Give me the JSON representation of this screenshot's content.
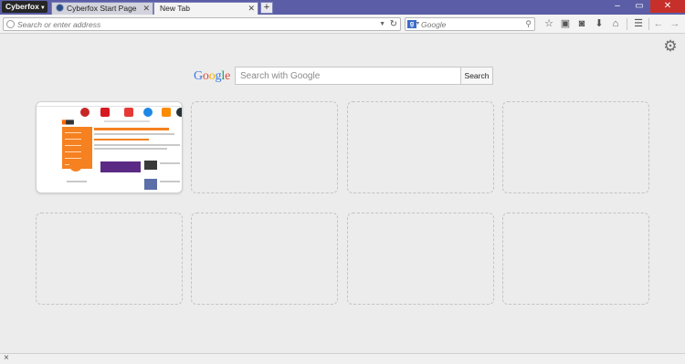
{
  "browser": {
    "app_menu_label": "Cyberfox",
    "tabs": [
      {
        "label": "Cyberfox Start Page",
        "favicon": "globe-icon",
        "active": false
      },
      {
        "label": "New Tab",
        "active": true
      }
    ],
    "new_tab_symbol": "+",
    "window_controls": {
      "minimize": "–",
      "maximize": "▭",
      "close": "✕"
    }
  },
  "navbar": {
    "url_placeholder": "Search or enter address",
    "search_placeholder": "Google",
    "toolbar_icons": [
      "bookmark-star-icon",
      "reading-list-icon",
      "pocket-icon",
      "download-icon",
      "home-icon",
      "menu-icon",
      "back-icon",
      "forward-icon"
    ]
  },
  "newtab": {
    "google_logo": "Google",
    "search_placeholder": "Search with Google",
    "search_button": "Search",
    "settings_icon": "gear-icon",
    "tiles_count": 8,
    "filled_tiles": 1
  },
  "statusbar": {
    "close_icon": "×"
  },
  "colors": {
    "tabstrip": "#5b5ea6",
    "close_button": "#c7302a",
    "thumbnail_accent": "#f58120"
  }
}
